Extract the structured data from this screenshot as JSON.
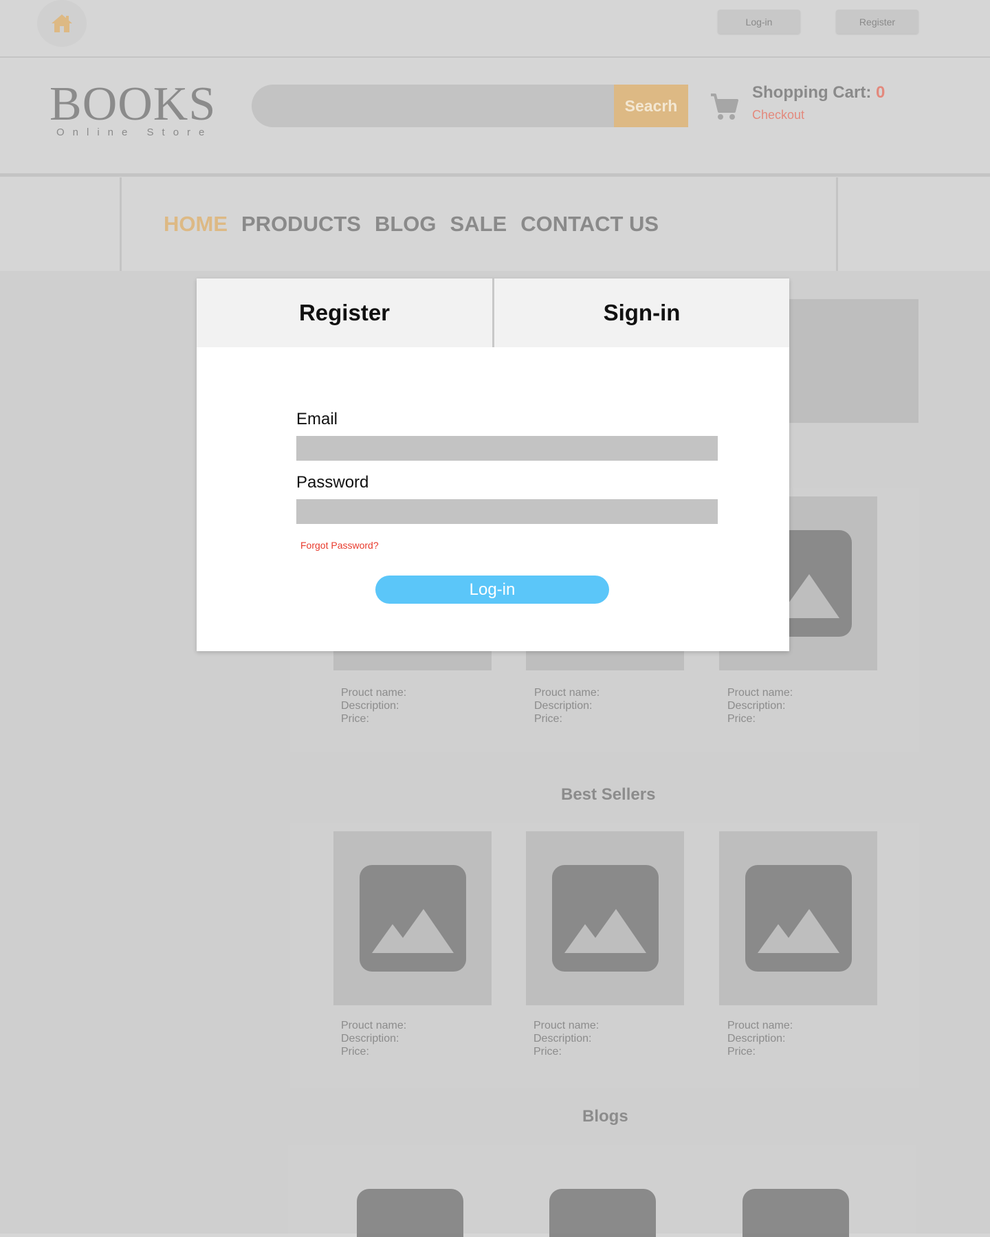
{
  "topbar": {
    "home_icon": "home-icon",
    "login_label": "Log-in",
    "register_label": "Register"
  },
  "logo": {
    "title": "BOOKS",
    "subtitle": "Online Store"
  },
  "search": {
    "placeholder": "",
    "button_label": "Seacrh"
  },
  "cart": {
    "icon": "cart-icon",
    "label": "Shopping Cart:",
    "count": "0",
    "checkout_label": "Checkout"
  },
  "nav": {
    "items": [
      {
        "label": "HOME",
        "active": true
      },
      {
        "label": "PRODUCTS",
        "active": false
      },
      {
        "label": "BLOG",
        "active": false
      },
      {
        "label": "SALE",
        "active": false
      },
      {
        "label": "CONTACT US",
        "active": false
      }
    ]
  },
  "colors": {
    "accent": "#ddb984",
    "cart_highlight": "#e3897d",
    "login_button": "#5bc6f9",
    "forgot_link": "#e83a2c"
  },
  "product_rows": [
    {
      "cards": [
        {
          "name": "Prouct name:",
          "description": "Description:",
          "price": "Price:"
        },
        {
          "name": "Prouct name:",
          "description": "Description:",
          "price": "Price:"
        },
        {
          "name": "Prouct name:",
          "description": "Description:",
          "price": "Price:"
        }
      ]
    },
    {
      "title": "Best Sellers",
      "cards": [
        {
          "name": "Prouct name:",
          "description": "Description:",
          "price": "Price:"
        },
        {
          "name": "Prouct name:",
          "description": "Description:",
          "price": "Price:"
        },
        {
          "name": "Prouct name:",
          "description": "Description:",
          "price": "Price:"
        }
      ]
    }
  ],
  "blogs": {
    "title": "Blogs"
  },
  "modal": {
    "tabs": [
      {
        "label": "Register"
      },
      {
        "label": "Sign-in"
      }
    ],
    "email_label": "Email",
    "email_value": "",
    "password_label": "Password",
    "password_value": "",
    "forgot_label": "Forgot Password?",
    "login_button_label": "Log-in"
  }
}
